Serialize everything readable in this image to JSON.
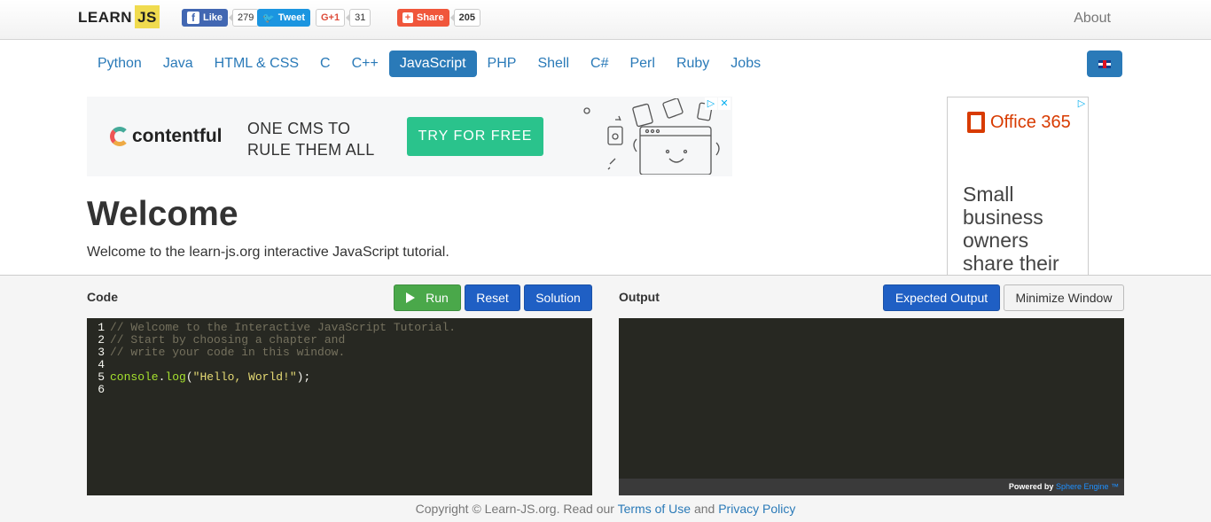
{
  "header": {
    "logo_learn": "LEARN",
    "logo_js": "JS",
    "about": "About",
    "social": {
      "fb_label": "Like",
      "fb_count": "279",
      "tw_label": "Tweet",
      "gp_label": "G+1",
      "gp_count": "31",
      "share_label": "Share",
      "share_count": "205"
    }
  },
  "nav": {
    "items": [
      "Python",
      "Java",
      "HTML & CSS",
      "C",
      "C++",
      "JavaScript",
      "PHP",
      "Shell",
      "C#",
      "Perl",
      "Ruby",
      "Jobs"
    ],
    "active": "JavaScript"
  },
  "ads": {
    "contentful": {
      "logo": "contentful",
      "tagline_1": "ONE CMS TO",
      "tagline_2": "RULE THEM ALL",
      "cta": "TRY FOR FREE"
    },
    "office": {
      "logo": "Office 365",
      "lines": [
        "Small",
        "business",
        "owners",
        "share their"
      ]
    }
  },
  "main": {
    "title": "Welcome",
    "intro": "Welcome to the learn-js.org interactive JavaScript tutorial."
  },
  "code_panel": {
    "label": "Code",
    "run": "Run",
    "reset": "Reset",
    "solution": "Solution",
    "lines": [
      {
        "n": "1",
        "text": "// Welcome to the Interactive JavaScript Tutorial."
      },
      {
        "n": "2",
        "text": "// Start by choosing a chapter and"
      },
      {
        "n": "3",
        "text": "// write your code in this window."
      },
      {
        "n": "4",
        "text": ""
      },
      {
        "n": "5",
        "obj": "console",
        "dot": ".",
        "fn": "log",
        "open": "(",
        "str": "\"Hello, World!\"",
        "close": ");"
      },
      {
        "n": "6",
        "text": ""
      }
    ]
  },
  "output_panel": {
    "label": "Output",
    "expected": "Expected Output",
    "minimize": "Minimize Window",
    "powered_by": "Powered by",
    "engine": "Sphere Engine ™"
  },
  "footer": {
    "copyright": "Copyright © Learn-JS.org. Read our",
    "terms": "Terms of Use",
    "and": "and",
    "privacy": "Privacy Policy"
  }
}
